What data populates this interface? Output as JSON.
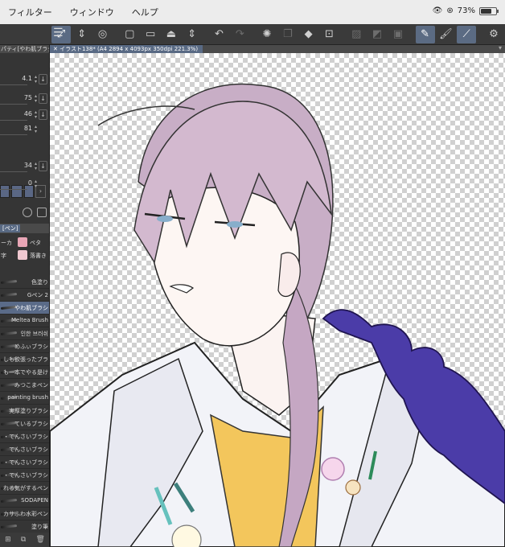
{
  "menu": {
    "items": [
      "フィルター",
      "ウィンドウ",
      "ヘルプ"
    ]
  },
  "status": {
    "battery": "73%",
    "battery_level": 0.73
  },
  "toolbar": {
    "icons": [
      "menu-icon",
      "transform-icon",
      "updown-icon",
      "view-icon",
      "new-icon",
      "open-icon",
      "save-icon",
      "undo-icon",
      "redo-icon",
      "loading-icon",
      "copy-icon",
      "fill-icon",
      "select-icon",
      "mask-icon",
      "layer-icon",
      "pen-icon",
      "brush-icon",
      "ruler-icon",
      "settings-icon"
    ]
  },
  "tab": {
    "label": "イラスト138* (A4 2894 x 4093px 350dpi 221.3%)"
  },
  "panel": {
    "title": "パティ[やわ肌ブラシ",
    "values": [
      "4.1",
      "75",
      "46",
      "81",
      "34",
      "0"
    ],
    "subtool_tab": "[ペン]",
    "subtool_items": [
      {
        "left": "ーカ",
        "right": "ペタ"
      },
      {
        "left": "字",
        "right": "落書き"
      }
    ],
    "brushes": [
      "色塗り",
      "Gペン 2",
      "やわ肌ブラシ",
      "Meltea Brush",
      "인한 브러쉬",
      "めふぃブラシ",
      "しも欲張ったブラ",
      "も一本でやる是け",
      "みつこまペン",
      "painting brush",
      "実厚塗りブラシ",
      "ているブラシ",
      "・てんさいブラシ",
      "てんさいブラシ",
      "・てんさいブラシ",
      "・てんさいブラシ",
      "れる気がするペン",
      "SODAPEN",
      "カサふわ水彩ペン",
      "塗り筆"
    ],
    "selected_brush": "やわ肌ブラシ"
  }
}
